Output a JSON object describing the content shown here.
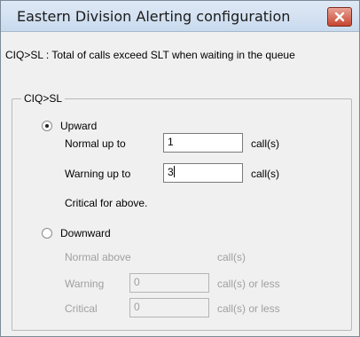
{
  "window": {
    "title": "Eastern Division  Alerting configuration"
  },
  "description": "CIQ>SL  : Total of calls exceed SLT when waiting in the queue",
  "group": {
    "legend": "CIQ>SL",
    "upward": {
      "label": "Upward",
      "selected": true,
      "normal_label": "Normal up to",
      "normal_value": "1",
      "normal_unit": "call(s)",
      "warning_label": "Warning up to",
      "warning_value": "3",
      "warning_unit": "call(s)",
      "critical_text": "Critical for above."
    },
    "downward": {
      "label": "Downward",
      "selected": false,
      "normal_label": "Normal above",
      "normal_unit": "call(s)",
      "warning_label": "Warning",
      "warning_value": "0",
      "warning_unit": "call(s) or less",
      "critical_label": "Critical",
      "critical_value": "0",
      "critical_unit": "call(s) or less"
    }
  },
  "colors": {
    "titlebar": "#c9daee",
    "close_button": "#c7452f",
    "disabled_text": "#a0a0a0"
  }
}
